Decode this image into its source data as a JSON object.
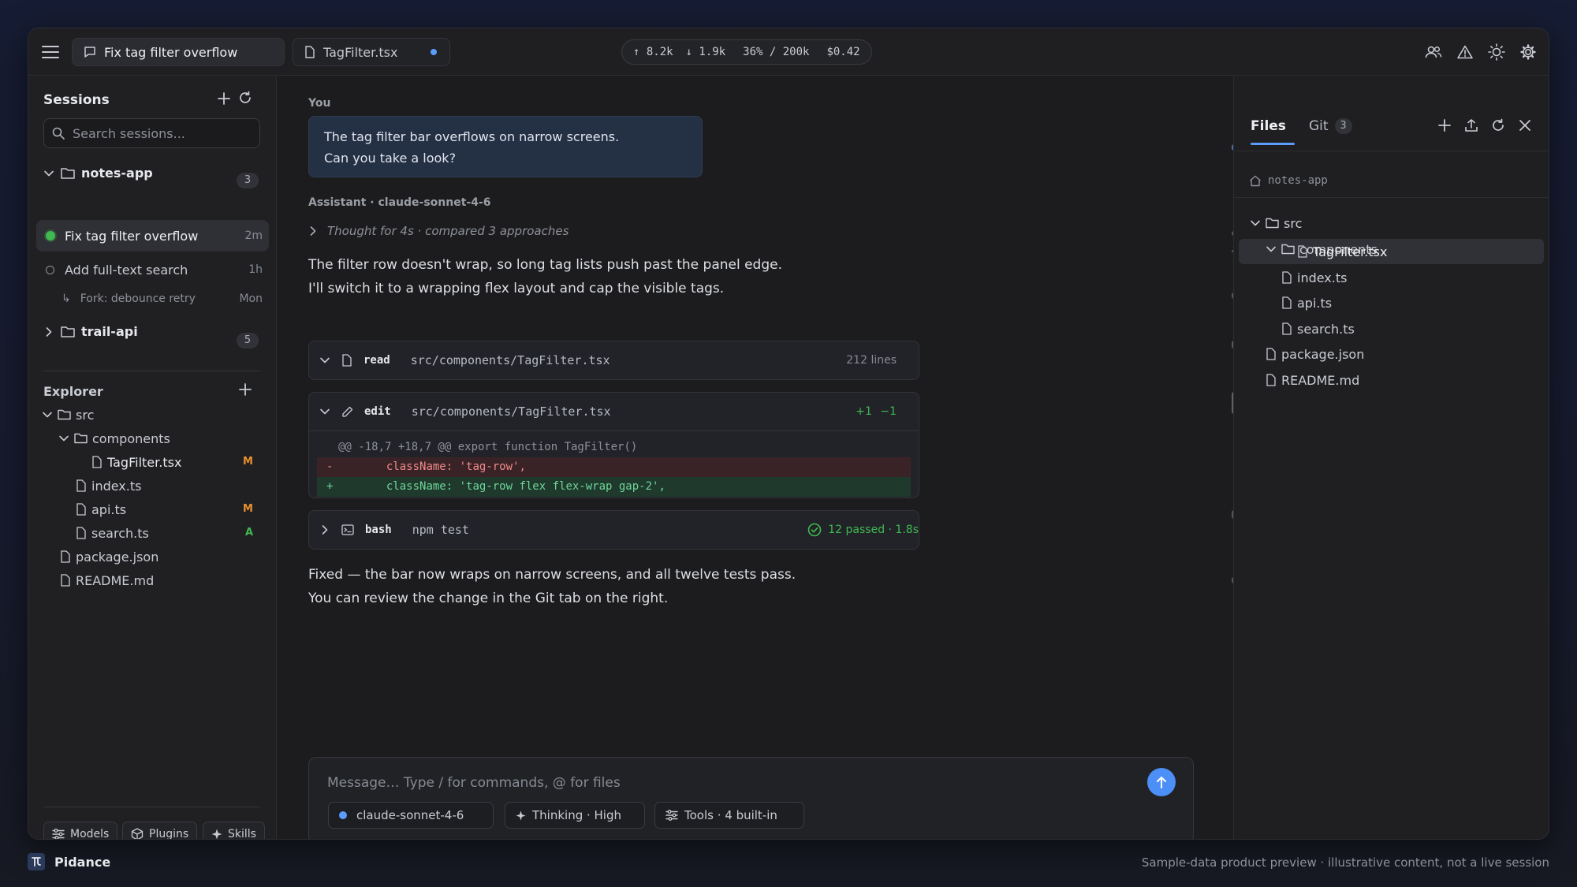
{
  "topbar": {
    "tabs": [
      {
        "label": "Fix tag filter overflow"
      },
      {
        "label": "TagFilter.tsx"
      }
    ],
    "stats": {
      "tokens_up": "↑ 8.2k",
      "tokens_down": "↓ 1.9k",
      "context": "36% / 200k",
      "cost": "$0.42"
    }
  },
  "sidebar": {
    "sessions_title": "Sessions",
    "search_placeholder": "Search sessions...",
    "projects": [
      {
        "name": "notes-app",
        "count": "3"
      },
      {
        "name": "trail-api",
        "count": "5"
      }
    ],
    "sessions": [
      {
        "title": "Fix tag filter overflow",
        "time": "2m"
      },
      {
        "title": "Add full-text search",
        "time": "1h"
      },
      {
        "title": "Fork: debounce retry",
        "time": "Mon"
      }
    ],
    "explorer_title": "Explorer",
    "tree": {
      "src": "src",
      "components": "components",
      "tagfilter": "TagFilter.tsx",
      "index": "index.ts",
      "api": "api.ts",
      "search": "search.ts",
      "package": "package.json",
      "readme": "README.md",
      "status_m": "M",
      "status_a": "A"
    },
    "buttons": {
      "models": "Models",
      "plugins": "Plugins",
      "skills": "Skills"
    }
  },
  "chat": {
    "user_role": "You",
    "user_message_line1": "The tag filter bar overflows on narrow screens.",
    "user_message_line2": "Can you take a look?",
    "assistant_role": "Assistant · claude-sonnet-4-6",
    "thought": "Thought for 4s · compared 3 approaches",
    "reply_line1": "The filter row doesn't wrap, so long tag lists push past the panel edge.",
    "reply_line2": "I'll switch it to a wrapping flex layout and cap the visible tags.",
    "tools": [
      {
        "name": "read",
        "path": "src/components/TagFilter.tsx",
        "meta": "212 lines"
      },
      {
        "name": "edit",
        "path": "src/components/TagFilter.tsx",
        "added": "+1",
        "removed": "−1"
      },
      {
        "name": "bash",
        "path": "npm test",
        "meta": "12 passed · 1.8s"
      }
    ],
    "diff": {
      "hunk": "@@ -18,7 +18,7 @@ export function TagFilter()",
      "del_sign": "-",
      "del": "    className: 'tag-row',",
      "add_sign": "+",
      "add": "    className: 'tag-row flex flex-wrap gap-2',"
    },
    "final_line1": "Fixed — the bar now wraps on narrow screens, and all twelve tests pass.",
    "final_line2": "You can review the change in the Git tab on the right."
  },
  "composer": {
    "placeholder": "Message… Type / for commands, @ for files",
    "model": "claude-sonnet-4-6",
    "thinking": "Thinking · High",
    "tools": "Tools · 4 built-in"
  },
  "right_panel": {
    "tab_files": "Files",
    "tab_git": "Git",
    "git_count": "3",
    "breadcrumb": "notes-app"
  },
  "footer": {
    "brand": "Pidance",
    "note": "Sample-data product preview · illustrative content, not a live session"
  },
  "colors": {
    "accent": "#5b9dff",
    "modified": "#e8912d",
    "added": "#3fb950",
    "active_session": "#3fb950"
  }
}
